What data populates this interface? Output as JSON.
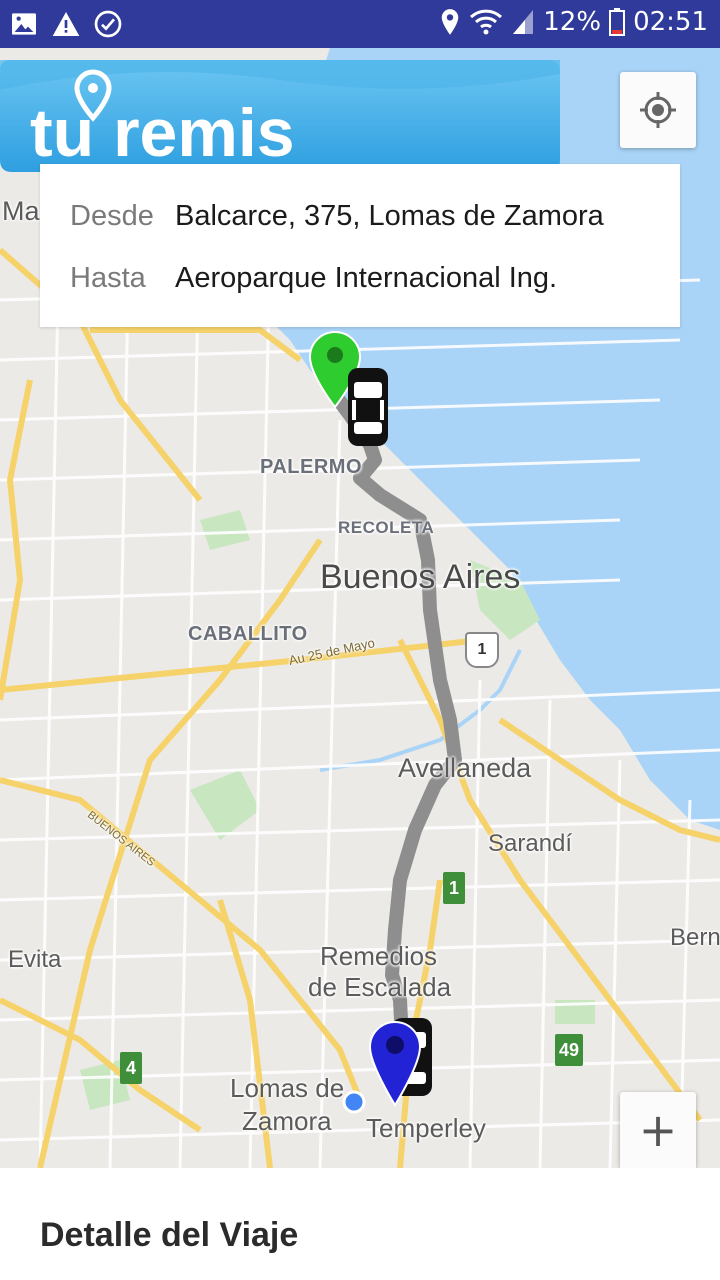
{
  "status_bar": {
    "battery": "12%",
    "time": "02:51",
    "icons": [
      "image-icon",
      "warning-icon",
      "check-circle-icon",
      "location-icon",
      "wifi-icon",
      "signal-icon",
      "battery-icon"
    ]
  },
  "app": {
    "logo_text": "tu remis",
    "accent_color": "#3aa9e4"
  },
  "route": {
    "from_label": "Desde",
    "from_value": "Balcarce, 375, Lomas de Zamora",
    "to_label": "Hasta",
    "to_value": "Aeroparque Internacional Ing."
  },
  "map": {
    "labels": {
      "ma": "Ma",
      "palermo": "PALERMO",
      "recoleta": "RECOLETA",
      "buenos_aires": "Buenos Aires",
      "caballito": "CABALLITO",
      "au25": "Au 25 de Mayo",
      "avellaneda": "Avellaneda",
      "sarandi": "Sarandí",
      "buenos_aires_road": "BUENOS AIRES",
      "bern": "Bern",
      "evita": "Evita",
      "remedios": "Remedios",
      "de_escalada": "de Escalada",
      "lomas_de": "Lomas de",
      "zamora": "Zamora",
      "temperley": "Temperley"
    },
    "shields": {
      "r1_top": "1",
      "r1_green": "1",
      "r4": "4",
      "r49": "49"
    },
    "zoom_in_label": "+"
  },
  "bottom_sheet": {
    "title": "Detalle del Viaje"
  }
}
